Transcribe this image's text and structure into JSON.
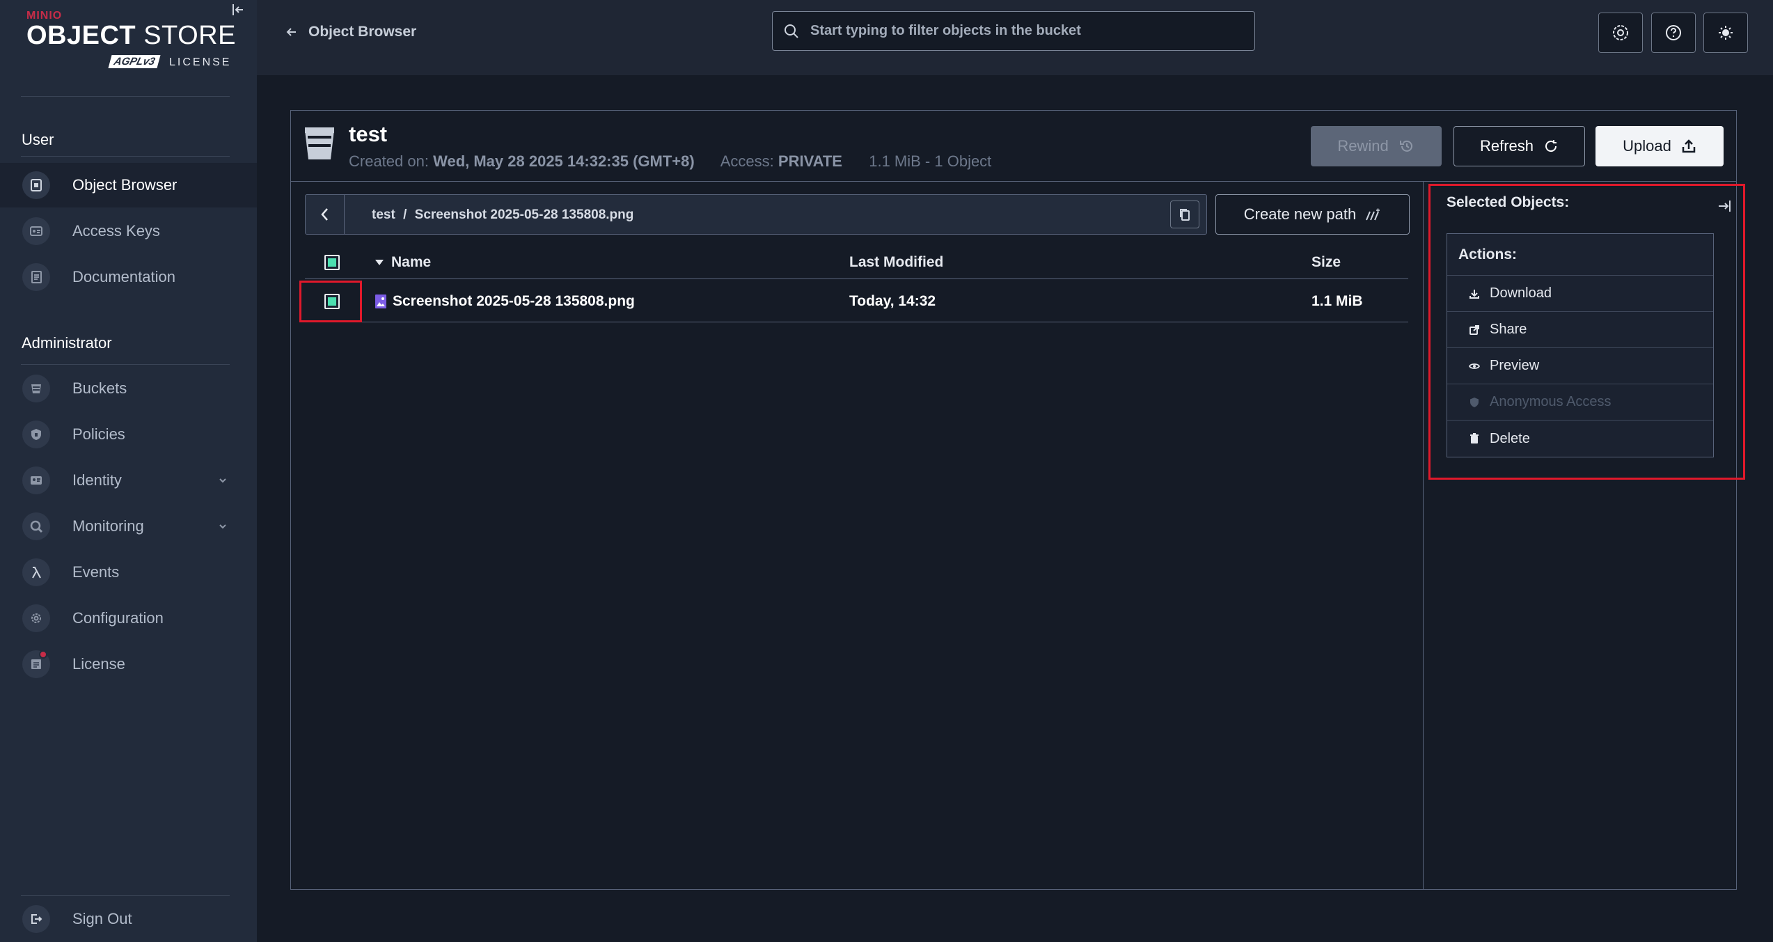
{
  "brand": {
    "minio": "MINIO",
    "product_bold": "OBJECT",
    "product_light": "STORE",
    "agpl": "AGPLv3",
    "license": "LICENSE"
  },
  "sidebar": {
    "user_section": "User",
    "user_items": [
      {
        "label": "Object Browser",
        "icon": "object-browser-icon",
        "active": true
      },
      {
        "label": "Access Keys",
        "icon": "access-keys-icon"
      },
      {
        "label": "Documentation",
        "icon": "documentation-icon"
      }
    ],
    "admin_section": "Administrator",
    "admin_items": [
      {
        "label": "Buckets",
        "icon": "buckets-icon"
      },
      {
        "label": "Policies",
        "icon": "policies-icon"
      },
      {
        "label": "Identity",
        "icon": "identity-icon",
        "expandable": true
      },
      {
        "label": "Monitoring",
        "icon": "monitoring-icon",
        "expandable": true
      },
      {
        "label": "Events",
        "icon": "lambda-icon"
      },
      {
        "label": "Configuration",
        "icon": "gear-icon"
      },
      {
        "label": "License",
        "icon": "license-icon",
        "badge": true
      }
    ],
    "sign_out": "Sign Out"
  },
  "topbar": {
    "back_label": "Object Browser",
    "search_placeholder": "Start typing to filter objects in the bucket",
    "buttons": [
      "settings-icon",
      "help-icon",
      "theme-toggle-icon"
    ]
  },
  "bucket": {
    "name": "test",
    "created_label": "Created on:",
    "created_value": "Wed, May 28 2025 14:32:35 (GMT+8)",
    "access_label": "Access:",
    "access_value": "PRIVATE",
    "summary": "1.1 MiB - 1 Object",
    "rewind_label": "Rewind",
    "refresh_label": "Refresh",
    "upload_label": "Upload"
  },
  "breadcrumb": {
    "root": "test",
    "separator": "/",
    "file": "Screenshot 2025-05-28 135808.png"
  },
  "create_path_label": "Create new path",
  "table": {
    "columns": {
      "name": "Name",
      "modified": "Last Modified",
      "size": "Size"
    },
    "rows": [
      {
        "name": "Screenshot 2025-05-28 135808.png",
        "modified": "Today, 14:32",
        "size": "1.1 MiB",
        "selected": true
      }
    ]
  },
  "selection_panel": {
    "title": "Selected Objects:",
    "actions_title": "Actions:",
    "actions": [
      {
        "label": "Download",
        "icon": "download-icon",
        "enabled": true
      },
      {
        "label": "Share",
        "icon": "share-icon",
        "enabled": true
      },
      {
        "label": "Preview",
        "icon": "eye-icon",
        "enabled": true
      },
      {
        "label": "Anonymous Access",
        "icon": "shield-icon",
        "enabled": false
      },
      {
        "label": "Delete",
        "icon": "trash-icon",
        "enabled": true
      }
    ]
  },
  "colors": {
    "accent_green": "#4ddfb0",
    "highlight_red": "#e0192b",
    "brand_red": "#c72c48"
  }
}
